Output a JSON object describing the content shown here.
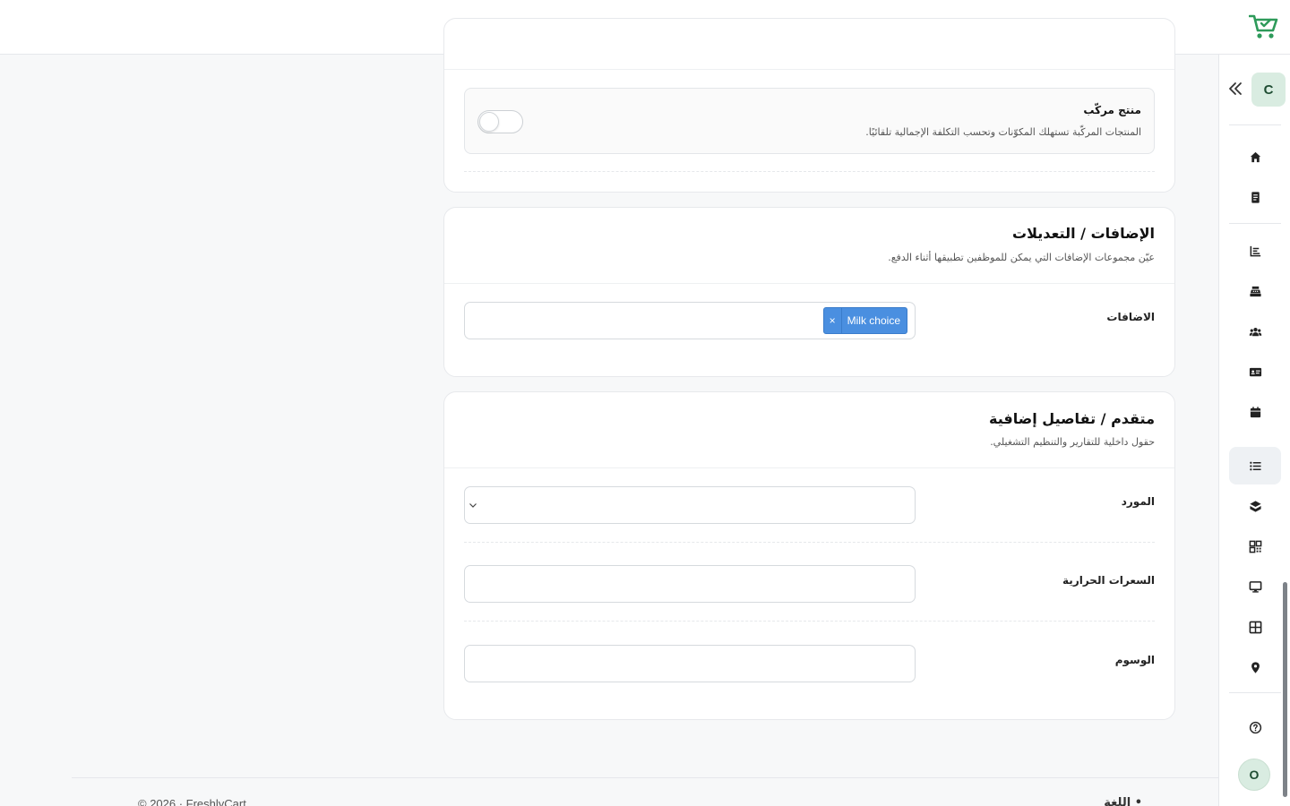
{
  "header": {
    "logo_icon": "shopping-cart-check-icon",
    "brand_color": "#2e9a5a"
  },
  "sidebar": {
    "workspace_initial": "C",
    "user_initial": "O",
    "items": [
      {
        "name": "home",
        "icon": "home-icon"
      },
      {
        "name": "orders",
        "icon": "receipt-icon"
      },
      {
        "name": "reports",
        "icon": "chart-icon"
      },
      {
        "name": "register",
        "icon": "cash-register-icon"
      },
      {
        "name": "customers",
        "icon": "users-icon"
      },
      {
        "name": "cards",
        "icon": "id-card-icon"
      },
      {
        "name": "calendar",
        "icon": "calendar-icon"
      },
      {
        "name": "products",
        "icon": "list-icon",
        "active": true
      },
      {
        "name": "inventory",
        "icon": "boxes-icon"
      },
      {
        "name": "qr",
        "icon": "qr-code-icon"
      },
      {
        "name": "devices",
        "icon": "desktop-icon"
      },
      {
        "name": "tables",
        "icon": "table-icon"
      },
      {
        "name": "locations",
        "icon": "map-pin-icon"
      },
      {
        "name": "help",
        "icon": "help-circle-icon"
      }
    ]
  },
  "composite": {
    "title": "منتج مركّب",
    "subtitle": "المنتجات المركّبة تستهلك المكوّنات وتحسب التكلفة الإجمالية تلقائيًا.",
    "enabled": false
  },
  "addons_section": {
    "title": "الإضافات / التعديلات",
    "subtitle": "عيّن مجموعات الإضافات التي يمكن للموظفين تطبيقها أثناء الدفع.",
    "field_label": "الاضافات",
    "selected_tags": [
      {
        "label": "Milk choice",
        "remove": "×"
      }
    ],
    "tag_color": "#4a8fe0"
  },
  "advanced_section": {
    "title": "متقدم / تفاصيل إضافية",
    "subtitle": "حقول داخلية للتقارير والتنظيم التشغيلي.",
    "supplier_label": "المورد",
    "supplier_value": "",
    "calories_label": "السعرات الحرارية",
    "calories_value": "",
    "tags_label": "الوسوم",
    "tags_value": ""
  },
  "footer": {
    "copyright": "© 2026 · FreshlyCart",
    "language_label": "• اللغة"
  }
}
